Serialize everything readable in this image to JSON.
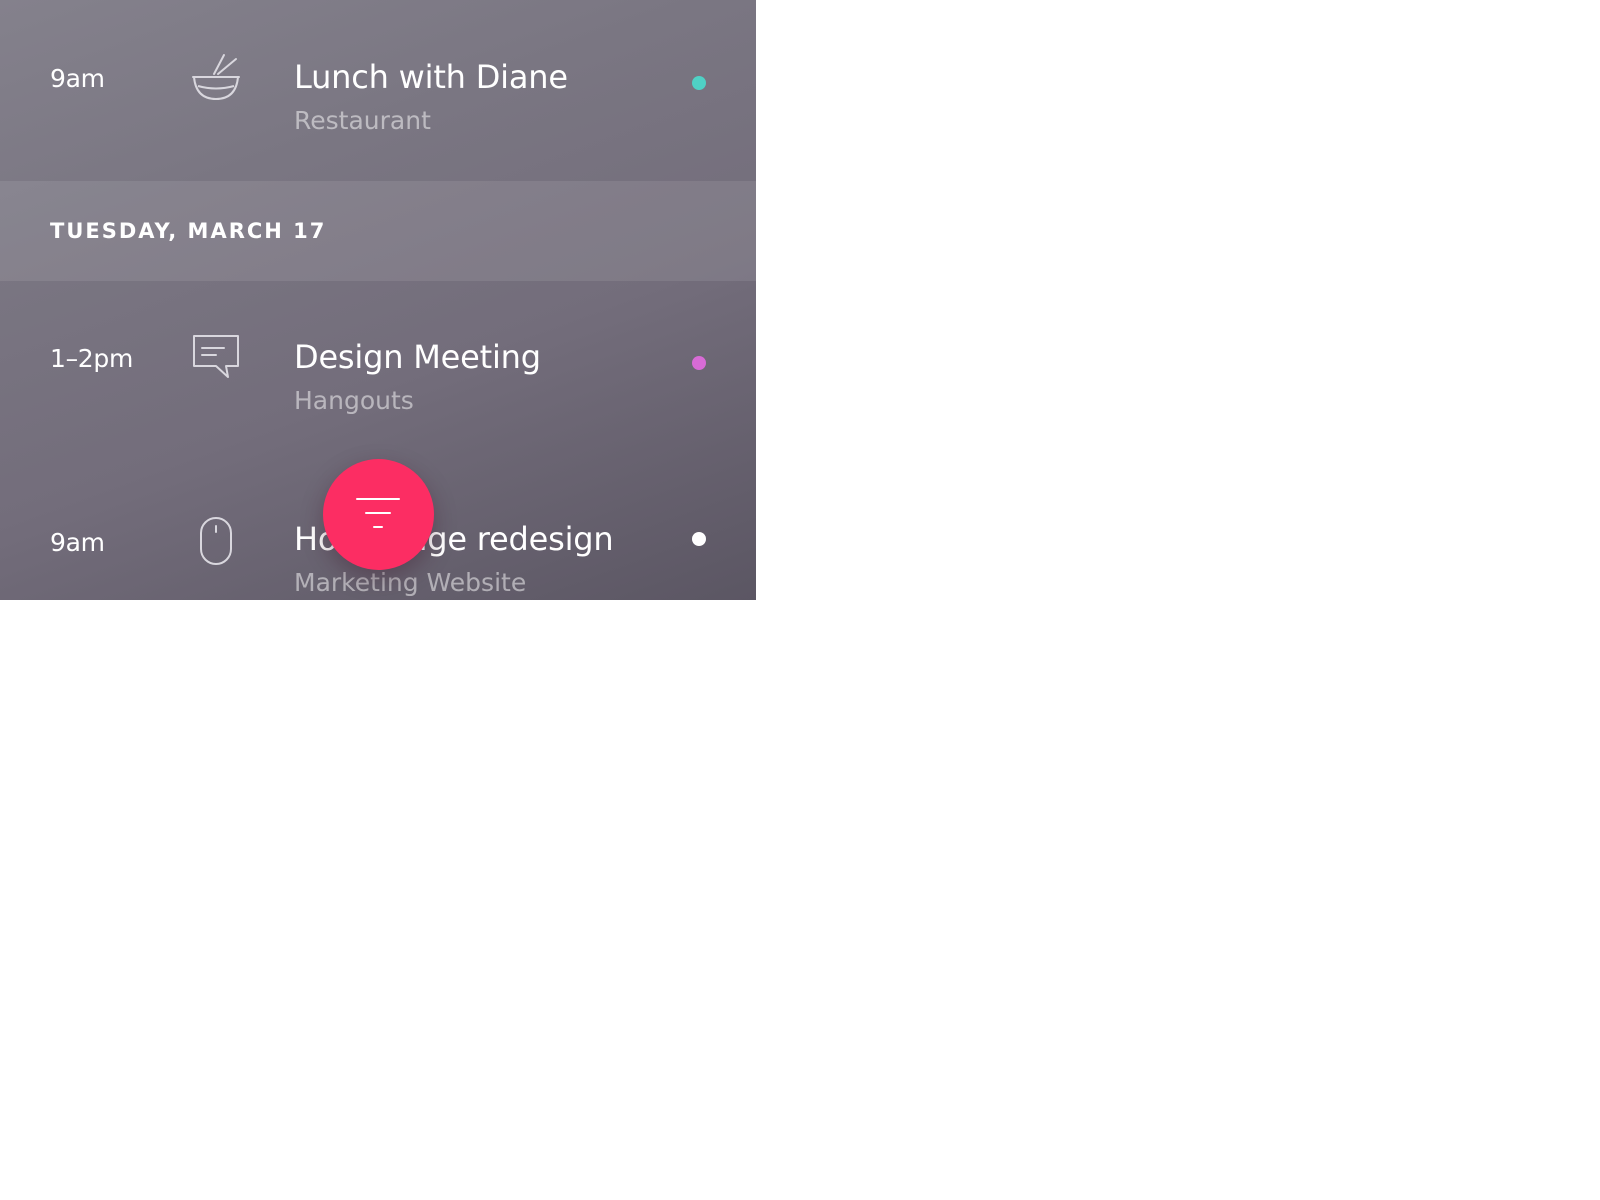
{
  "agenda": {
    "events_before": [
      {
        "time": "9am",
        "title": "Lunch with Diane",
        "subtitle": "Restaurant",
        "icon": "bowl-chopsticks-icon",
        "dot_color": "#4fd1c5"
      }
    ],
    "day_header": "TUESDAY, MARCH 17",
    "events_after": [
      {
        "time": "1–2pm",
        "title": "Design Meeting",
        "subtitle": "Hangouts",
        "icon": "chat-bubble-icon",
        "dot_color": "#d86bd6"
      },
      {
        "time": "9am",
        "title": "Homepage redesign",
        "subtitle": "Marketing Website",
        "icon": "mouse-icon",
        "dot_color": "#ffffff"
      }
    ]
  },
  "fab": {
    "icon": "filter-icon",
    "color": "#fc2d63"
  }
}
